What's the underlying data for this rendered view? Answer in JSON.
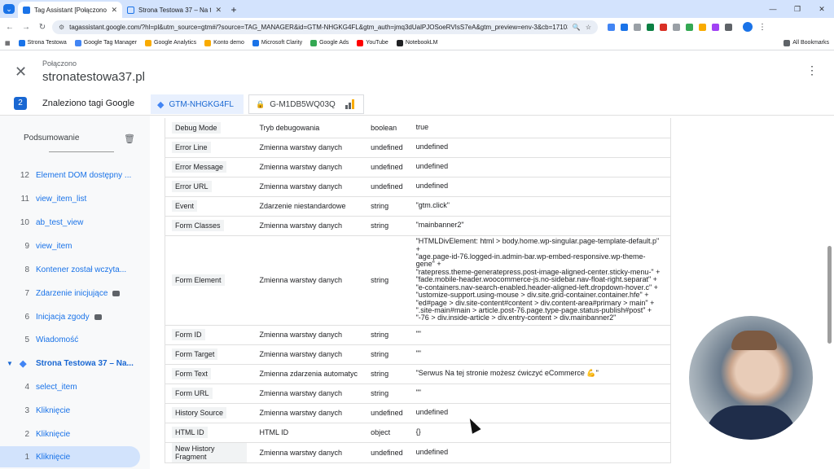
{
  "browser": {
    "tabs": [
      {
        "title": "Tag Assistant [Połączono]",
        "active": true
      },
      {
        "title": "Strona Testowa 37 – Na tej stro",
        "active": false
      }
    ],
    "url": "tagassistant.google.com/?hl=pl&utm_source=gtm#/?source=TAG_MANAGER&id=GTM-NHGKG4FL&gtm_auth=jmq3dUalPJOSoeRVIsS7eA&gtm_preview=env-3&cb=1710302202433330",
    "bookmarks": [
      "Strona Testowa",
      "Google Tag Manager",
      "Google Analytics",
      "Konto demo",
      "Microsoft Clarity",
      "Google Ads",
      "YouTube",
      "NotebookLM"
    ],
    "all_bookmarks": "All Bookmarks"
  },
  "header": {
    "status": "Połączono",
    "domain": "stronatestowa37.pl"
  },
  "tagbar": {
    "count": "2",
    "found_label": "Znaleziono tagi Google",
    "gtm_id": "GTM-NHGKG4FL",
    "ga_id": "G-M1DB5WQ03Q"
  },
  "sidebar": {
    "summary": "Podsumowanie",
    "events": [
      {
        "num": "12",
        "label": "Element DOM dostępny ...",
        "badge": false
      },
      {
        "num": "11",
        "label": "view_item_list",
        "badge": false
      },
      {
        "num": "10",
        "label": "ab_test_view",
        "badge": false
      },
      {
        "num": "9",
        "label": "view_item",
        "badge": false
      },
      {
        "num": "8",
        "label": "Kontener został wczyta...",
        "badge": false
      },
      {
        "num": "7",
        "label": "Zdarzenie inicjujące",
        "badge": true
      },
      {
        "num": "6",
        "label": "Inicjacja zgody",
        "badge": true
      },
      {
        "num": "5",
        "label": "Wiadomość",
        "badge": false
      }
    ],
    "page": "Strona Testowa 37 – Na...",
    "page_events": [
      {
        "num": "4",
        "label": "select_item"
      },
      {
        "num": "3",
        "label": "Kliknięcie"
      },
      {
        "num": "2",
        "label": "Kliknięcie"
      },
      {
        "num": "1",
        "label": "Kliknięcie"
      }
    ]
  },
  "variables": [
    {
      "name": "Debug Mode",
      "desc": "Tryb debugowania",
      "type": "boolean",
      "value": "true"
    },
    {
      "name": "Error Line",
      "desc": "Zmienna warstwy danych",
      "type": "undefined",
      "value": "undefined"
    },
    {
      "name": "Error Message",
      "desc": "Zmienna warstwy danych",
      "type": "undefined",
      "value": "undefined"
    },
    {
      "name": "Error URL",
      "desc": "Zmienna warstwy danych",
      "type": "undefined",
      "value": "undefined"
    },
    {
      "name": "Event",
      "desc": "Zdarzenie niestandardowe",
      "type": "string",
      "value": "\"gtm.click\""
    },
    {
      "name": "Form Classes",
      "desc": "Zmienna warstwy danych",
      "type": "string",
      "value": "\"mainbanner2\""
    },
    {
      "name": "Form Element",
      "desc": "Zmienna warstwy danych",
      "type": "string",
      "value": "\"HTMLDivElement: html > body.home.wp-singular.page-template-default.p\"\n+\n\"age.page-id-76.logged-in.admin-bar.wp-embed-responsive.wp-theme-\ngene\" +\n\"ratepress.theme-generatepress.post-image-aligned-center.sticky-menu-\" +\n\"fade.mobile-header.woocommerce-js.no-sidebar.nav-float-right.separat\" +\n\"e-containers.nav-search-enabled.header-aligned-left.dropdown-hover.c\" +\n\"ustomize-support.using-mouse > div.site.grid-container.container.hfe\" +\n\"ed#page > div.site-content#content > div.content-area#primary > main\" +\n\".site-main#main > article.post-76.page.type-page.status-publish#post\" +\n\"-76 > div.inside-article > div.entry-content > div.mainbanner2\"",
      "tall": true
    },
    {
      "name": "Form ID",
      "desc": "Zmienna warstwy danych",
      "type": "string",
      "value": "\"\""
    },
    {
      "name": "Form Target",
      "desc": "Zmienna warstwy danych",
      "type": "string",
      "value": "\"\""
    },
    {
      "name": "Form Text",
      "desc": "Zmienna zdarzenia automatyc",
      "type": "string",
      "value": "\"Serwus Na tej stronie możesz ćwiczyć eCommerce 💪\""
    },
    {
      "name": "Form URL",
      "desc": "Zmienna warstwy danych",
      "type": "string",
      "value": "\"\""
    },
    {
      "name": "History Source",
      "desc": "Zmienna warstwy danych",
      "type": "undefined",
      "value": "undefined"
    },
    {
      "name": "HTML ID",
      "desc": "HTML ID",
      "type": "object",
      "value": "{}"
    },
    {
      "name": "New History Fragment",
      "desc": "Zmienna warstwy danych",
      "type": "undefined",
      "value": "undefined"
    }
  ],
  "colors": {
    "accent": "#1967d2",
    "tagchip_bg": "#e8f0fe",
    "selected_bg": "#d2e3fc",
    "tabbar_bg": "#d3e3fd"
  }
}
